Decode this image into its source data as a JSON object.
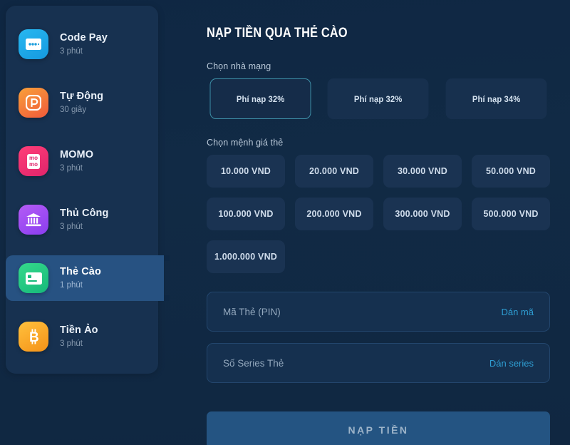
{
  "sidebar": {
    "items": [
      {
        "label": "Code Pay",
        "duration": "3 phút",
        "icon": "card-dots-icon",
        "active": false
      },
      {
        "label": "Tự Động",
        "duration": "30 giây",
        "icon": "p-logo-icon",
        "active": false
      },
      {
        "label": "MOMO",
        "duration": "3 phút",
        "icon": "momo-icon",
        "active": false
      },
      {
        "label": "Thủ Công",
        "duration": "3 phút",
        "icon": "bank-icon",
        "active": false
      },
      {
        "label": "Thẻ Cào",
        "duration": "1 phút",
        "icon": "scratch-card-icon",
        "active": true
      },
      {
        "label": "Tiền Ảo",
        "duration": "3 phút",
        "icon": "bitcoin-icon",
        "active": false
      }
    ]
  },
  "main": {
    "title": "Nạp tiền qua thẻ cào",
    "carrier_label": "Chọn nhà mạng",
    "carriers": [
      {
        "label": "Phí nạp 32%",
        "selected": true
      },
      {
        "label": "Phí nạp 32%",
        "selected": false
      },
      {
        "label": "Phí nạp 34%",
        "selected": false
      }
    ],
    "denomination_label": "Chọn mệnh giá thẻ",
    "denominations": [
      "10.000 VND",
      "20.000 VND",
      "30.000 VND",
      "50.000 VND",
      "100.000 VND",
      "200.000 VND",
      "300.000 VND",
      "500.000 VND",
      "1.000.000 VND"
    ],
    "pin_field": {
      "placeholder": "Mã Thẻ (PIN)",
      "value": "",
      "action": "Dán mã"
    },
    "serial_field": {
      "placeholder": "Số Series Thẻ",
      "value": "",
      "action": "Dán series"
    },
    "submit_label": "NẠP TIỀN"
  },
  "colors": {
    "page_bg": "#112a45",
    "sidebar_bg": "#173150",
    "active_item": "#275482",
    "accent_link": "#2f9fd4",
    "selected_border": "#3f93ab",
    "submit_bg": "#245482"
  }
}
